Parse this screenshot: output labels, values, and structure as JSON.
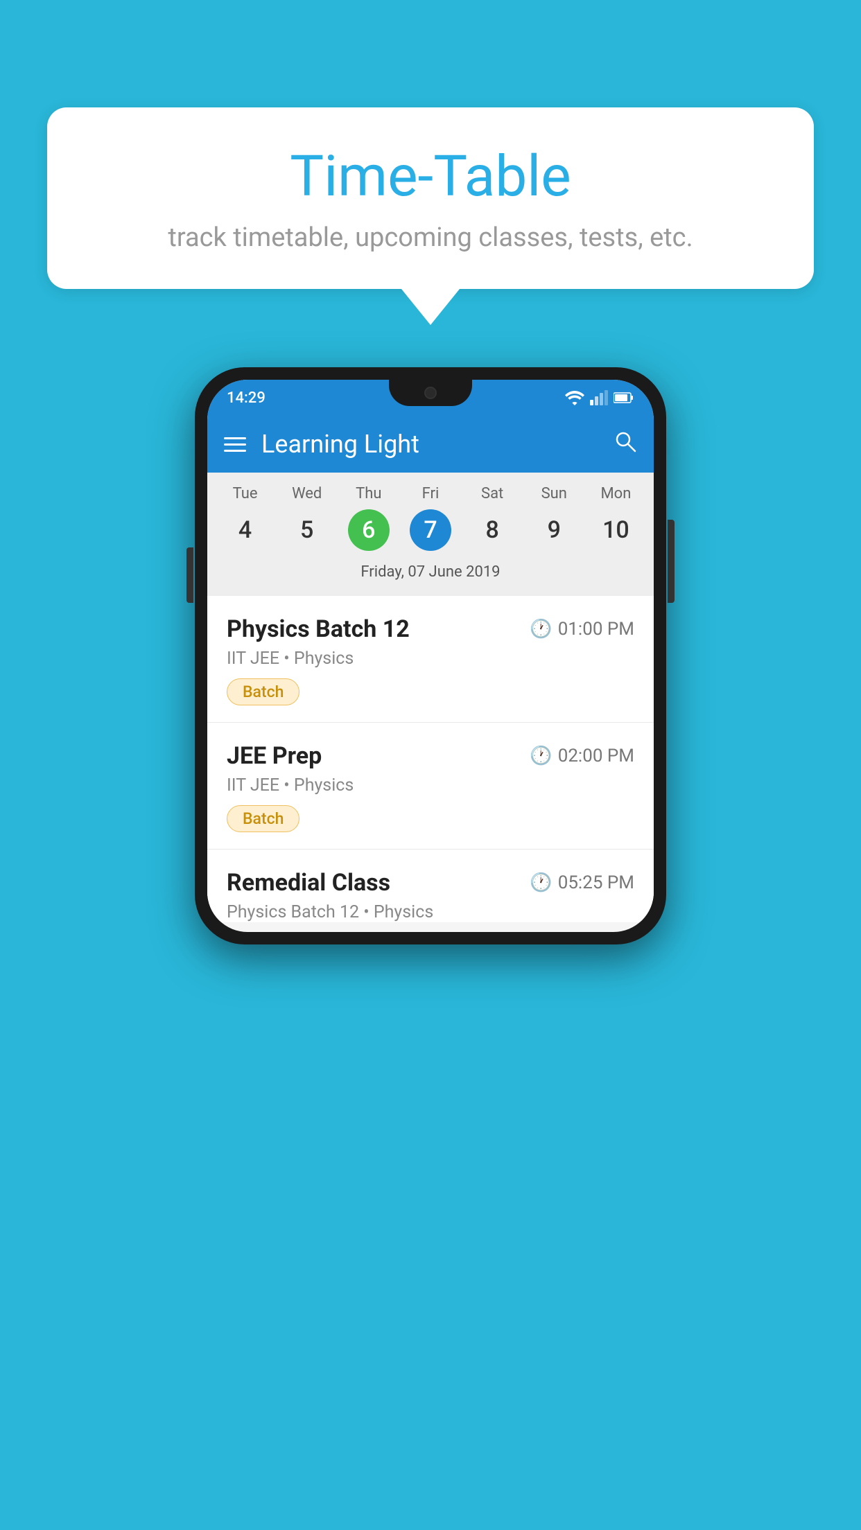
{
  "background_color": "#29b6d8",
  "speech_bubble": {
    "title": "Time-Table",
    "subtitle": "track timetable, upcoming classes, tests, etc."
  },
  "phone": {
    "status_bar": {
      "time": "14:29",
      "icons": [
        "wifi",
        "signal",
        "battery"
      ]
    },
    "app_header": {
      "title": "Learning Light",
      "menu_icon": "hamburger-icon",
      "search_icon": "search-icon"
    },
    "calendar": {
      "days": [
        {
          "label": "Tue",
          "number": "4"
        },
        {
          "label": "Wed",
          "number": "5"
        },
        {
          "label": "Thu",
          "number": "6",
          "state": "today"
        },
        {
          "label": "Fri",
          "number": "7",
          "state": "selected"
        },
        {
          "label": "Sat",
          "number": "8"
        },
        {
          "label": "Sun",
          "number": "9"
        },
        {
          "label": "Mon",
          "number": "10"
        }
      ],
      "selected_date_label": "Friday, 07 June 2019"
    },
    "schedule": [
      {
        "name": "Physics Batch 12",
        "time": "01:00 PM",
        "subtitle": "IIT JEE • Physics",
        "badge": "Batch"
      },
      {
        "name": "JEE Prep",
        "time": "02:00 PM",
        "subtitle": "IIT JEE • Physics",
        "badge": "Batch"
      },
      {
        "name": "Remedial Class",
        "time": "05:25 PM",
        "subtitle": "Physics Batch 12 • Physics",
        "badge": null
      }
    ]
  }
}
